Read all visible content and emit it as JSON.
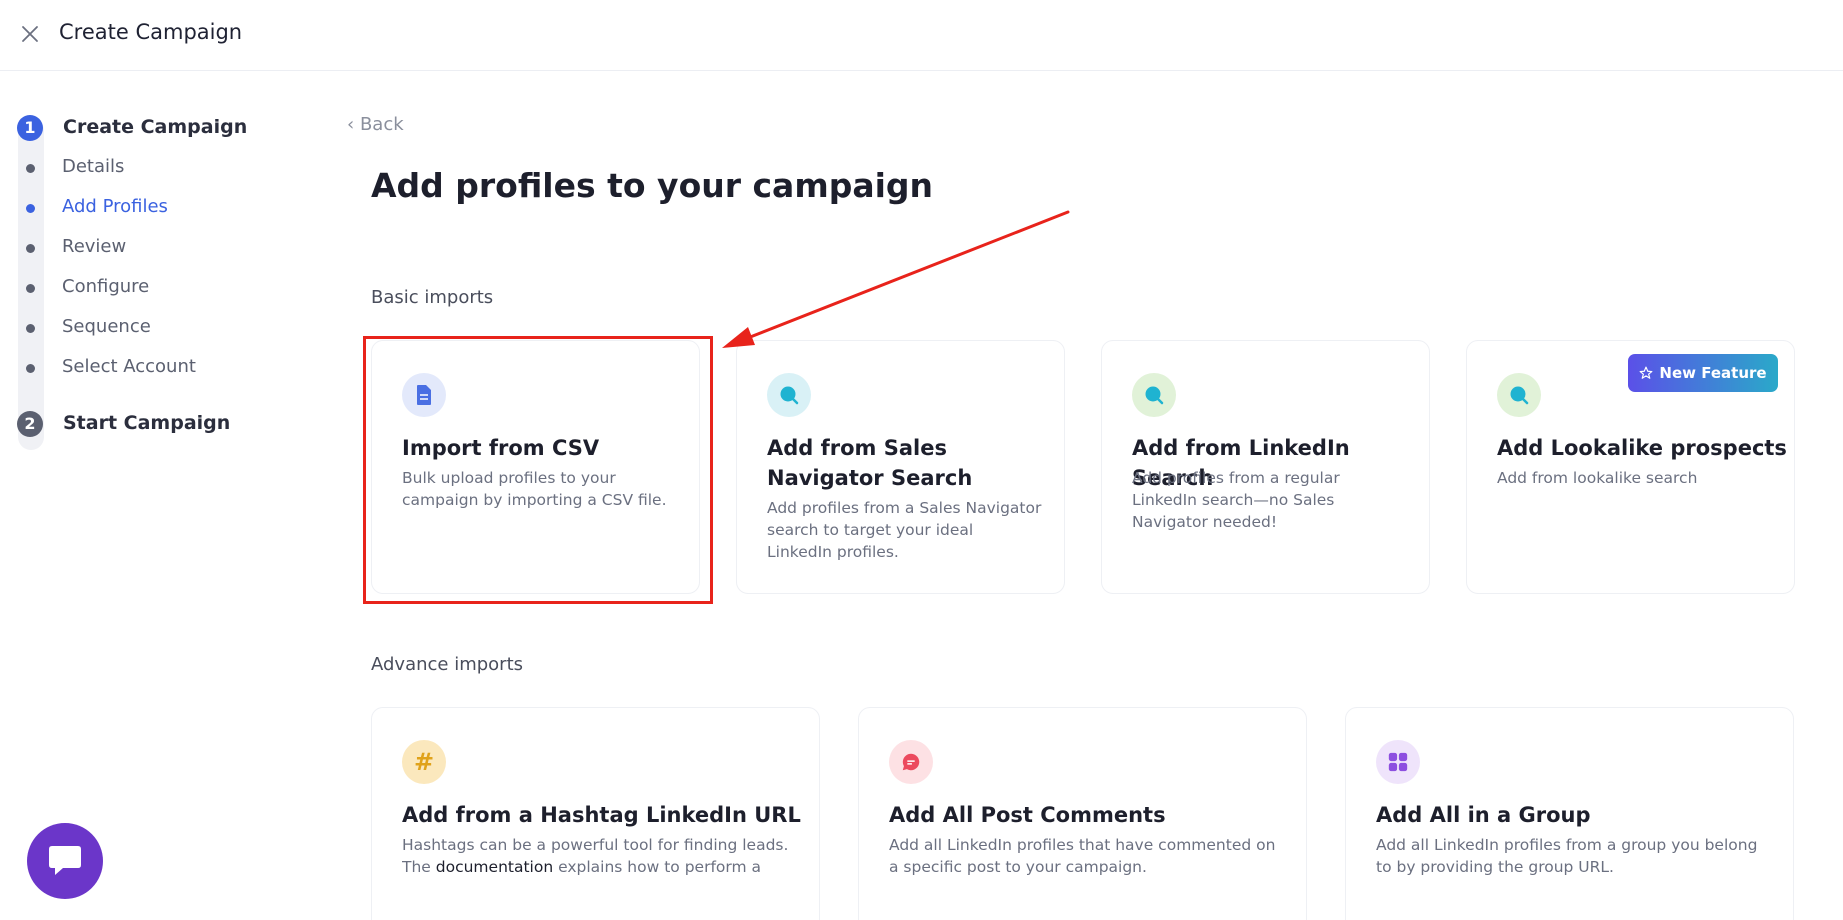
{
  "header": {
    "title": "Create Campaign",
    "close_icon": "close-icon"
  },
  "stepper": {
    "step1": {
      "number": "1",
      "title": "Create Campaign"
    },
    "items": [
      {
        "label": "Details",
        "active": false
      },
      {
        "label": "Add Profiles",
        "active": true
      },
      {
        "label": "Review",
        "active": false
      },
      {
        "label": "Configure",
        "active": false
      },
      {
        "label": "Sequence",
        "active": false
      },
      {
        "label": "Select Account",
        "active": false
      }
    ],
    "step2": {
      "number": "2",
      "title": "Start Campaign"
    }
  },
  "main": {
    "back_label": "Back",
    "title": "Add profiles to your campaign",
    "basic_label": "Basic imports",
    "advance_label": "Advance imports",
    "basic_cards": [
      {
        "title": "Import from CSV",
        "desc": "Bulk upload profiles to your campaign by importing a CSV file.",
        "icon": "document-icon"
      },
      {
        "title": "Add from Sales Navigator Search",
        "desc": "Add profiles from a Sales Navigator search to target your ideal LinkedIn profiles.",
        "icon": "search-icon"
      },
      {
        "title": "Add from LinkedIn Search",
        "desc": "Add profiles from a regular LinkedIn search—no Sales Navigator needed!",
        "icon": "search-icon"
      },
      {
        "title": "Add Lookalike prospects",
        "desc": "Add from lookalike search",
        "icon": "search-icon",
        "badge": "New Feature"
      }
    ],
    "advance_cards": [
      {
        "title": "Add from a Hashtag LinkedIn URL",
        "desc_pre": "Hashtags can be a powerful tool for finding leads. The ",
        "desc_link": "documentation",
        "desc_post": " explains how to perform a hashtag search.",
        "icon": "hashtag-icon"
      },
      {
        "title": "Add All Post Comments",
        "desc": "Add all LinkedIn profiles that have commented on a specific post to your campaign.",
        "icon": "comment-icon"
      },
      {
        "title": "Add All in a Group",
        "desc": "Add all LinkedIn profiles from a group you belong to by providing the group URL.",
        "icon": "grid-icon"
      }
    ]
  },
  "colors": {
    "accent": "#3b62e0",
    "highlight": "#e8231b",
    "chat": "#6b36c9"
  }
}
